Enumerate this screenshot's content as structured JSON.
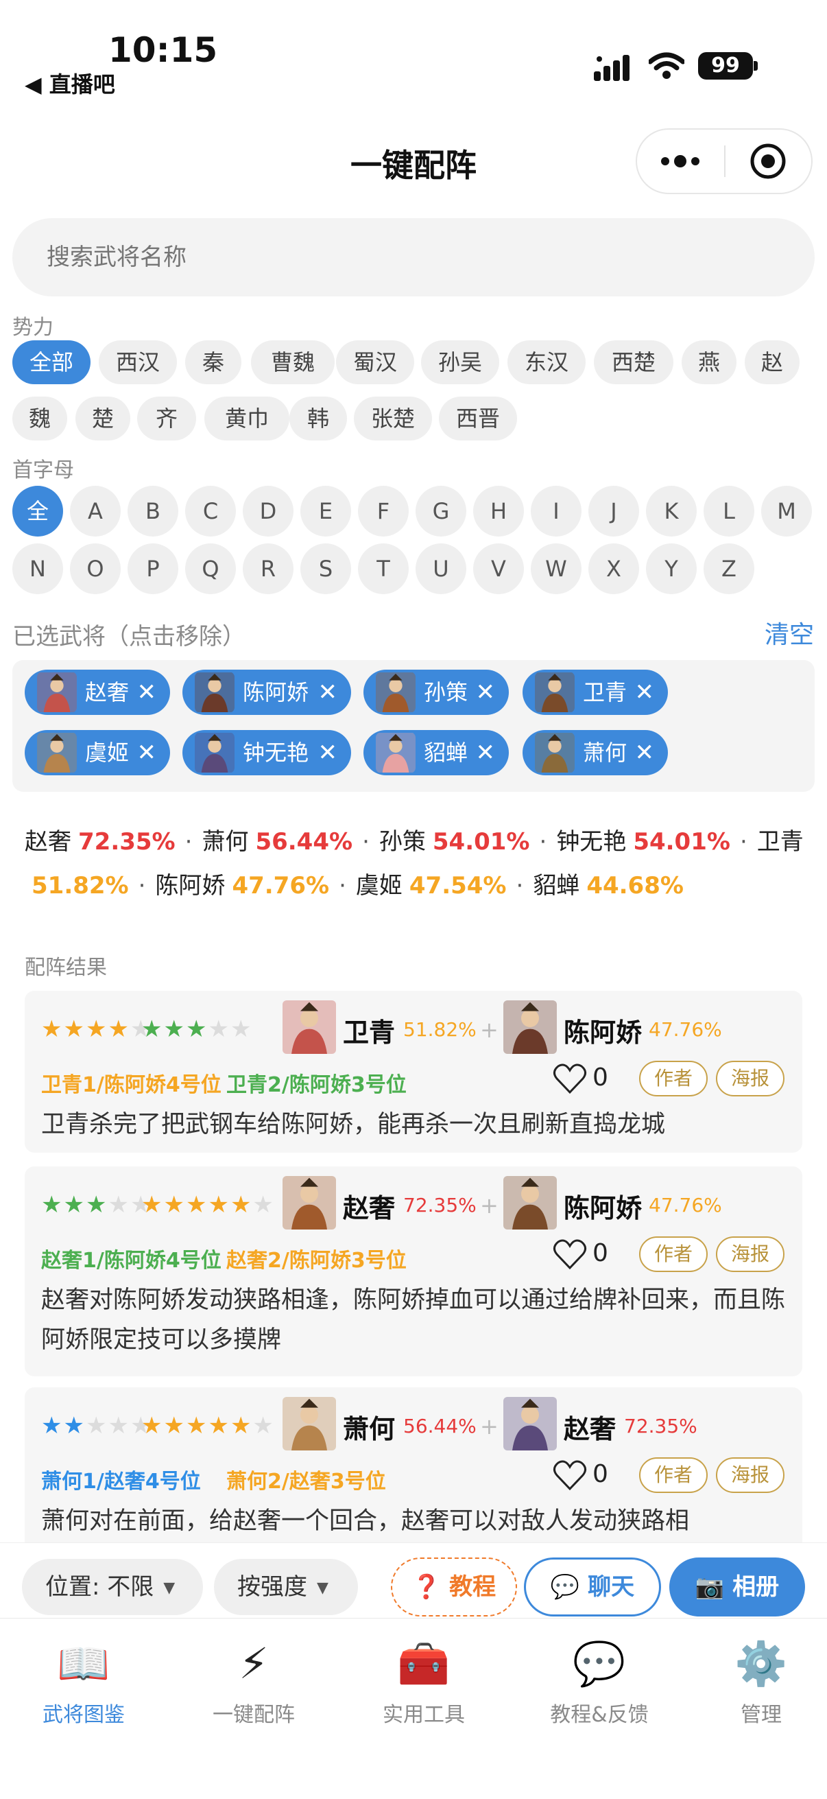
{
  "status": {
    "time": "10:15",
    "back_app": "◀ 直播吧",
    "battery": "99"
  },
  "nav": {
    "title": "一键配阵"
  },
  "search": {
    "placeholder": "搜索武将名称"
  },
  "faction": {
    "label": "势力",
    "chips": [
      "全部",
      "西汉",
      "秦",
      "曹魏",
      "蜀汉",
      "孙吴",
      "东汉",
      "西楚",
      "燕",
      "赵",
      "魏",
      "楚",
      "齐",
      "黄巾",
      "韩",
      "张楚",
      "西晋"
    ],
    "selected": "全部"
  },
  "initials": {
    "label": "首字母",
    "letters": [
      "全",
      "A",
      "B",
      "C",
      "D",
      "E",
      "F",
      "G",
      "H",
      "I",
      "J",
      "K",
      "L",
      "M",
      "N",
      "O",
      "P",
      "Q",
      "R",
      "S",
      "T",
      "U",
      "V",
      "W",
      "X",
      "Y",
      "Z"
    ],
    "selected": "全"
  },
  "selected_heroes": {
    "label": "已选武将（点击移除）",
    "clear": "清空",
    "items": [
      "赵奢",
      "陈阿娇",
      "孙策",
      "卫青",
      "虞姬",
      "钟无艳",
      "貂蝉",
      "萧何"
    ],
    "remove_glyph": "✕"
  },
  "stats": [
    {
      "name": "赵奢",
      "pct": "72.35%",
      "color": "#e63b3b"
    },
    {
      "name": "萧何",
      "pct": "56.44%",
      "color": "#e63b3b"
    },
    {
      "name": "孙策",
      "pct": "54.01%",
      "color": "#e63b3b"
    },
    {
      "name": "钟无艳",
      "pct": "54.01%",
      "color": "#e63b3b"
    },
    {
      "name": "卫青",
      "pct": "51.82%",
      "color": "#f5a623"
    },
    {
      "name": "陈阿娇",
      "pct": "47.76%",
      "color": "#f5a623"
    },
    {
      "name": "虞姬",
      "pct": "47.54%",
      "color": "#f5a623"
    },
    {
      "name": "貂蝉",
      "pct": "44.68%",
      "color": "#f5a623"
    }
  ],
  "results": {
    "label": "配阵结果",
    "cards": [
      {
        "stars_a": {
          "filled": 4,
          "total": 5,
          "color": "orange"
        },
        "stars_b": {
          "filled": 3,
          "total": 5,
          "color": "green"
        },
        "hero_a": "卫青",
        "pct_a": "51.82%",
        "hero_b": "陈阿娇",
        "pct_b": "47.76%",
        "plus": "+",
        "pos_a": "卫青1/陈阿娇4号位",
        "pos_b": "卫青2/陈阿娇3号位",
        "pos_a_color": "#f5a623",
        "pos_b_color": "#4caf50",
        "likes": "0",
        "author": "作者",
        "poster": "海报",
        "desc": "卫青杀完了把武钢车给陈阿娇，能再杀一次且刷新直捣龙城"
      },
      {
        "stars_a": {
          "filled": 3,
          "total": 5,
          "color": "green"
        },
        "stars_b": {
          "filled": 5,
          "total": 6,
          "color": "orange"
        },
        "hero_a": "赵奢",
        "pct_a": "72.35%",
        "hero_b": "陈阿娇",
        "pct_b": "47.76%",
        "plus": "+",
        "pos_a": "赵奢1/陈阿娇4号位",
        "pos_b": "赵奢2/陈阿娇3号位",
        "pos_a_color": "#4caf50",
        "pos_b_color": "#f5a623",
        "likes": "0",
        "author": "作者",
        "poster": "海报",
        "desc": "赵奢对陈阿娇发动狭路相逢，陈阿娇掉血可以通过给牌补回来，而且陈阿娇限定技可以多摸牌"
      },
      {
        "stars_a": {
          "filled": 2,
          "total": 5,
          "color": "blue"
        },
        "stars_b": {
          "filled": 5,
          "total": 6,
          "color": "orange"
        },
        "hero_a": "萧何",
        "pct_a": "56.44%",
        "hero_b": "赵奢",
        "pct_b": "72.35%",
        "plus": "+",
        "pos_a": "萧何1/赵奢4号位",
        "pos_b": "萧何2/赵奢3号位",
        "pos_a_color": "#2f8ee6",
        "pos_b_color": "#f5a623",
        "likes": "0",
        "author": "作者",
        "poster": "海报",
        "desc": "萧何对在前面，给赵奢一个回合，赵奢可以对敌人发动狭路相"
      }
    ]
  },
  "toolbar": {
    "position": "位置: 不限",
    "order": "按强度",
    "caret": "▼",
    "tutorial": "❓ 教程",
    "chat": "💬 聊天",
    "album": "📷 相册"
  },
  "tabs": [
    {
      "label": "武将图鉴",
      "icon": "book-icon",
      "glyph": "📖",
      "active": true
    },
    {
      "label": "一键配阵",
      "icon": "lightning-icon",
      "glyph": "⚡",
      "active": false
    },
    {
      "label": "实用工具",
      "icon": "toolbox-icon",
      "glyph": "🧰",
      "active": false
    },
    {
      "label": "教程&反馈",
      "icon": "chat-bubble-icon",
      "glyph": "💬",
      "active": false
    },
    {
      "label": "管理",
      "icon": "gear-icon",
      "glyph": "⚙️",
      "active": false
    }
  ]
}
